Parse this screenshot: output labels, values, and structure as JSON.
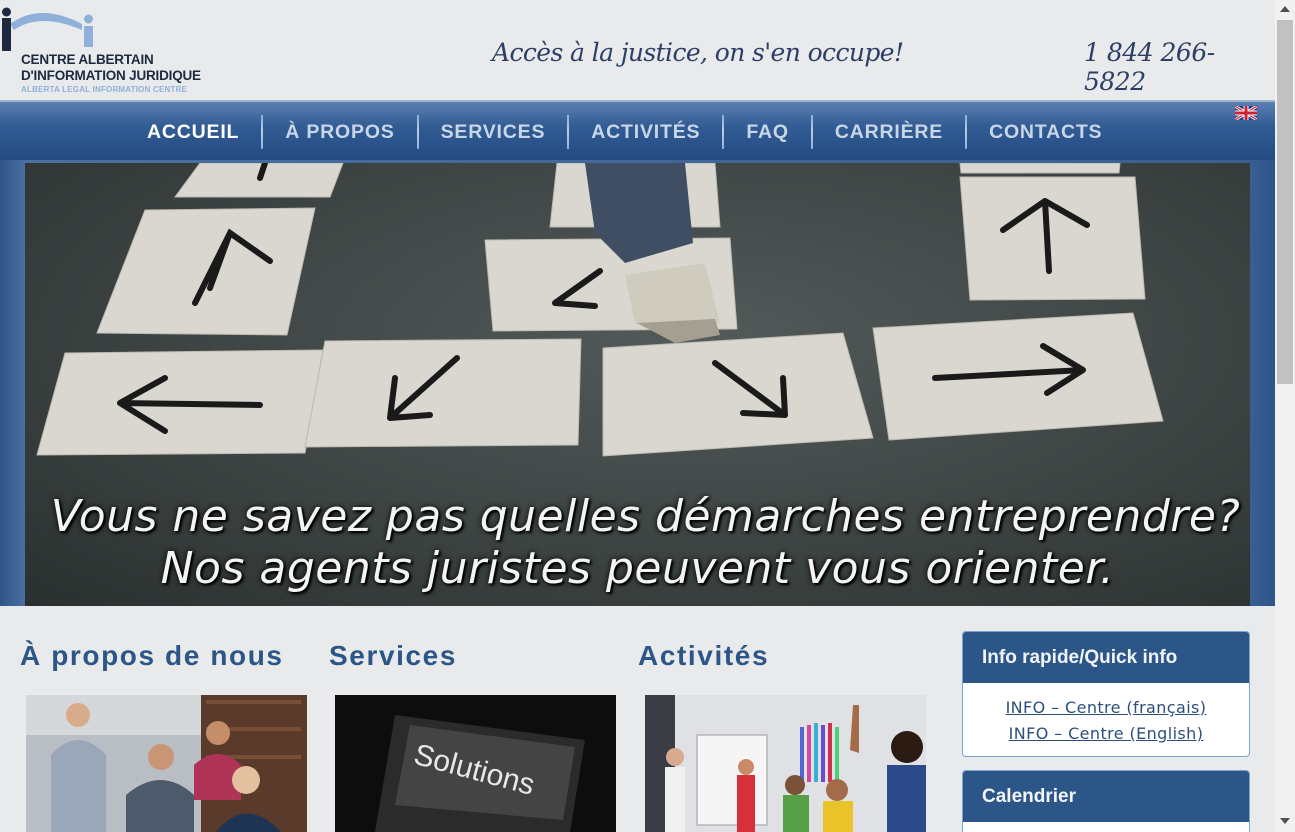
{
  "header": {
    "logo": {
      "line1": "CENTRE ALBERTAIN",
      "line2": "D'INFORMATION JURIDIQUE",
      "line3": "ALBERTA LEGAL INFORMATION CENTRE"
    },
    "tagline": "Accès à la justice, on s'en occupe!",
    "phone": "1 844 266-5822"
  },
  "nav": {
    "items": [
      {
        "label": "ACCUEIL",
        "active": true
      },
      {
        "label": "À PROPOS",
        "active": false
      },
      {
        "label": "SERVICES",
        "active": false
      },
      {
        "label": "ACTIVITÉS",
        "active": false
      },
      {
        "label": "FAQ",
        "active": false
      },
      {
        "label": "CARRIÈRE",
        "active": false
      },
      {
        "label": "CONTACTS",
        "active": false
      }
    ],
    "language_flag": "uk-flag-icon"
  },
  "hero": {
    "line1": "Vous ne savez pas quelles démarches entreprendre?",
    "line2": "Nos agents juristes peuvent vous orienter."
  },
  "columns": [
    {
      "title": "À propos de nous"
    },
    {
      "title": "Services",
      "image_text": "Solutions"
    },
    {
      "title": "Activités"
    }
  ],
  "sidebar": {
    "quick_info": {
      "title": "Info rapide/Quick info",
      "links": [
        "INFO – Centre (français)",
        "INFO – Centre (English)"
      ]
    },
    "calendar": {
      "title": "Calendrier"
    }
  },
  "colors": {
    "brand_blue": "#2d5688",
    "nav_text": "#c9d6e8",
    "background": "#e9eaeb"
  }
}
